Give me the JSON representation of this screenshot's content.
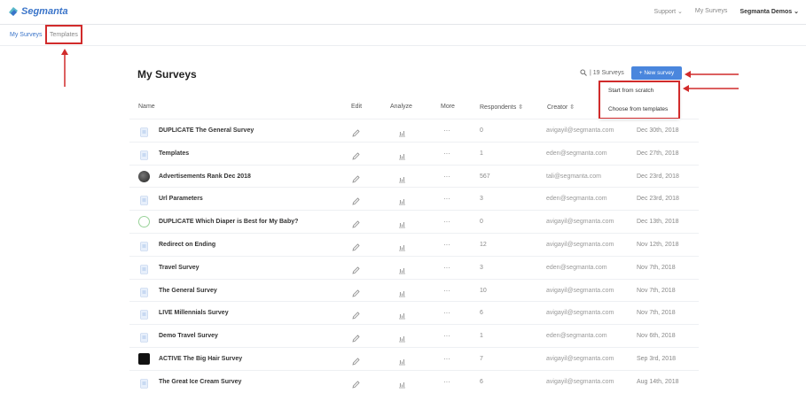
{
  "header": {
    "brand": "Segmanta",
    "nav": [
      "Support ⌄",
      "My Surveys",
      "Segmanta Demos ⌄"
    ]
  },
  "subnav": {
    "my_surveys": "My Surveys",
    "templates": "Templates"
  },
  "page_title": "My Surveys",
  "search": {
    "count": "19 Surveys"
  },
  "new_survey_label": "+ New survey",
  "dropdown": [
    "Start from scratch",
    "Choose from templates"
  ],
  "table": {
    "headers": {
      "name": "Name",
      "edit": "Edit",
      "analyze": "Analyze",
      "more": "More",
      "respondents": "Respondents ⇳",
      "creator": "Creator ⇳"
    },
    "rows": [
      {
        "name": "DUPLICATE The General Survey",
        "respondents": "0",
        "creator": "avigayil@segmanta.com",
        "date": "Dec 30th, 2018",
        "icon": "doc"
      },
      {
        "name": "Templates",
        "respondents": "1",
        "creator": "eden@segmanta.com",
        "date": "Dec 27th, 2018",
        "icon": "doc"
      },
      {
        "name": "Advertisements Rank Dec 2018",
        "respondents": "567",
        "creator": "tali@segmanta.com",
        "date": "Dec 23rd, 2018",
        "icon": "photo"
      },
      {
        "name": "Url Parameters",
        "respondents": "3",
        "creator": "eden@segmanta.com",
        "date": "Dec 23rd, 2018",
        "icon": "doc"
      },
      {
        "name": "DUPLICATE Which Diaper is Best for My Baby?",
        "respondents": "0",
        "creator": "avigayil@segmanta.com",
        "date": "Dec 13th, 2018",
        "icon": "logo"
      },
      {
        "name": "Redirect on Ending",
        "respondents": "12",
        "creator": "avigayil@segmanta.com",
        "date": "Nov 12th, 2018",
        "icon": "doc"
      },
      {
        "name": "Travel Survey",
        "respondents": "3",
        "creator": "eden@segmanta.com",
        "date": "Nov 7th, 2018",
        "icon": "doc"
      },
      {
        "name": "The General Survey",
        "respondents": "10",
        "creator": "avigayil@segmanta.com",
        "date": "Nov 7th, 2018",
        "icon": "doc"
      },
      {
        "name": "LIVE Millennials Survey",
        "respondents": "6",
        "creator": "avigayil@segmanta.com",
        "date": "Nov 7th, 2018",
        "icon": "doc"
      },
      {
        "name": "Demo Travel Survey",
        "respondents": "1",
        "creator": "eden@segmanta.com",
        "date": "Nov 6th, 2018",
        "icon": "doc"
      },
      {
        "name": "ACTIVE The Big Hair Survey",
        "respondents": "7",
        "creator": "avigayil@segmanta.com",
        "date": "Sep 3rd, 2018",
        "icon": "na"
      },
      {
        "name": "The Great Ice Cream Survey",
        "respondents": "6",
        "creator": "avigayil@segmanta.com",
        "date": "Aug 14th, 2018",
        "icon": "doc"
      }
    ]
  },
  "colors": {
    "accent": "#4a86dd",
    "annotation": "#d12b2b"
  }
}
